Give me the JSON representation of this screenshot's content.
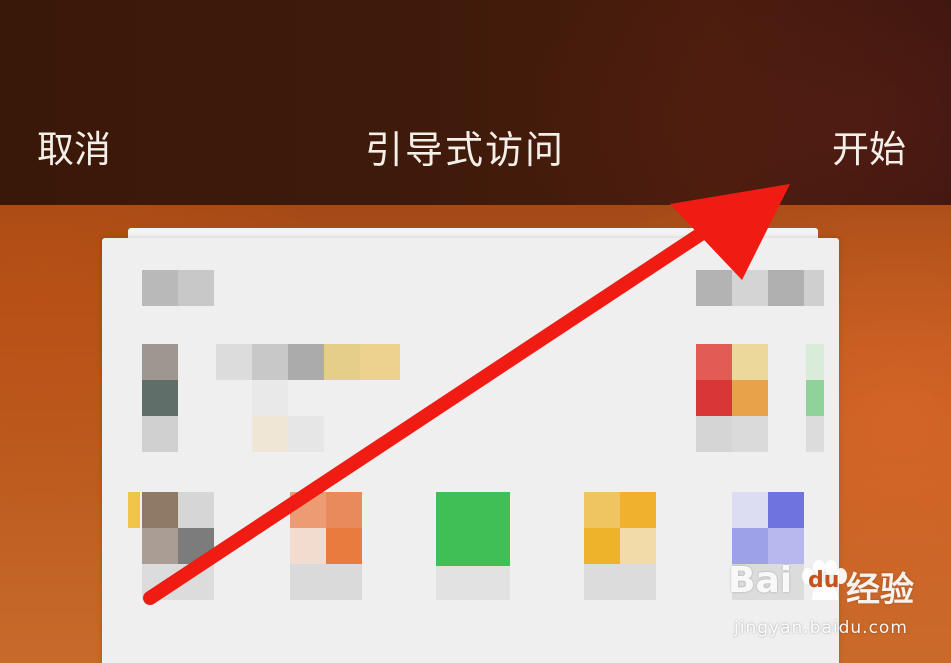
{
  "navbar": {
    "cancel_label": "取消",
    "title": "引导式访问",
    "start_label": "开始"
  },
  "watermark": {
    "logo_left": "Bai",
    "logo_right": "du",
    "logo_cn": "经验",
    "url": "jingyan.baidu.com"
  },
  "colors": {
    "topbar": "#3f1a0a",
    "background": "#b8561c",
    "arrow": "#f01c14",
    "nav_text": "#f4efe9"
  },
  "icons": [
    "pointer-arrow-annotation",
    "baidu-paw-icon"
  ]
}
